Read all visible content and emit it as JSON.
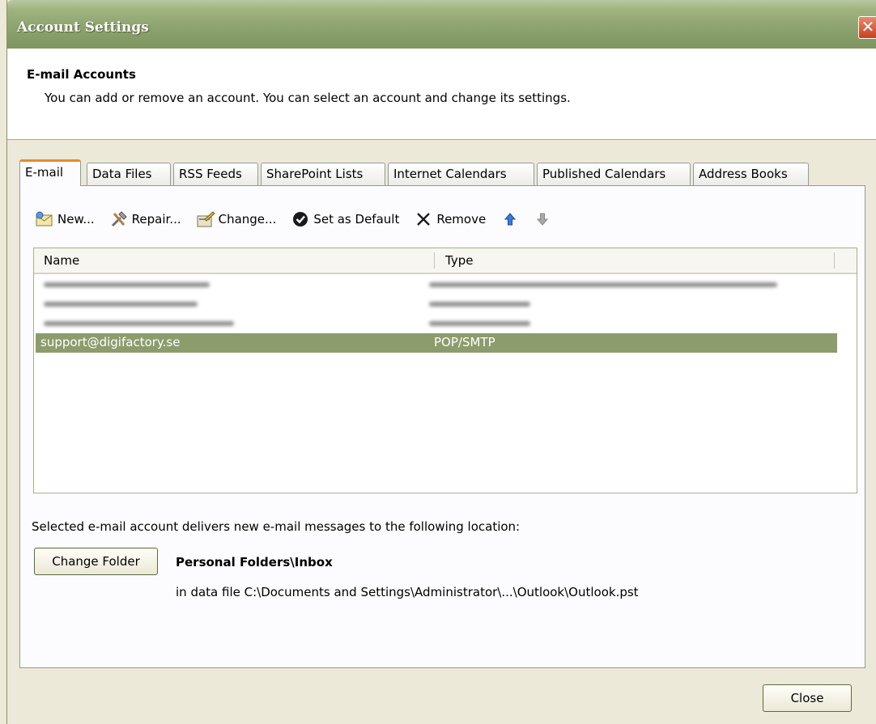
{
  "window": {
    "title": "Account Settings",
    "close_glyph": "✕"
  },
  "header": {
    "title": "E-mail Accounts",
    "description": "You can add or remove an account. You can select an account and change its settings."
  },
  "tabs": [
    {
      "label": "E-mail",
      "active": true
    },
    {
      "label": "Data Files"
    },
    {
      "label": "RSS Feeds"
    },
    {
      "label": "SharePoint Lists"
    },
    {
      "label": "Internet Calendars"
    },
    {
      "label": "Published Calendars"
    },
    {
      "label": "Address Books"
    }
  ],
  "toolbar": {
    "new_label": "New...",
    "repair_label": "Repair...",
    "change_label": "Change...",
    "default_label": "Set as Default",
    "remove_label": "Remove",
    "icons": [
      "new-email-icon",
      "repair-tools-icon",
      "change-icon",
      "checkmark-icon",
      "x-remove-icon",
      "arrow-up-icon",
      "arrow-down-icon"
    ]
  },
  "accounts": {
    "columns": [
      "Name",
      "Type"
    ],
    "rows": [
      {
        "name": "",
        "type": "",
        "redacted": true
      },
      {
        "name": "",
        "type": "",
        "redacted": true
      },
      {
        "name": "",
        "type": "",
        "redacted": true
      },
      {
        "name": "support@digifactory.se",
        "type": "POP/SMTP",
        "selected": true
      }
    ]
  },
  "delivery": {
    "text": "Selected e-mail account delivers new e-mail messages to the following location:",
    "change_folder_label": "Change Folder",
    "folder": "Personal Folders\\Inbox",
    "datafile": "in data file C:\\Documents and Settings\\Administrator\\...\\Outlook\\Outlook.pst"
  },
  "footer": {
    "close_label": "Close"
  },
  "colors": {
    "titlebar": "#8ea470",
    "selection": "#8c9c6c",
    "tab_accent": "#e68b2c"
  }
}
